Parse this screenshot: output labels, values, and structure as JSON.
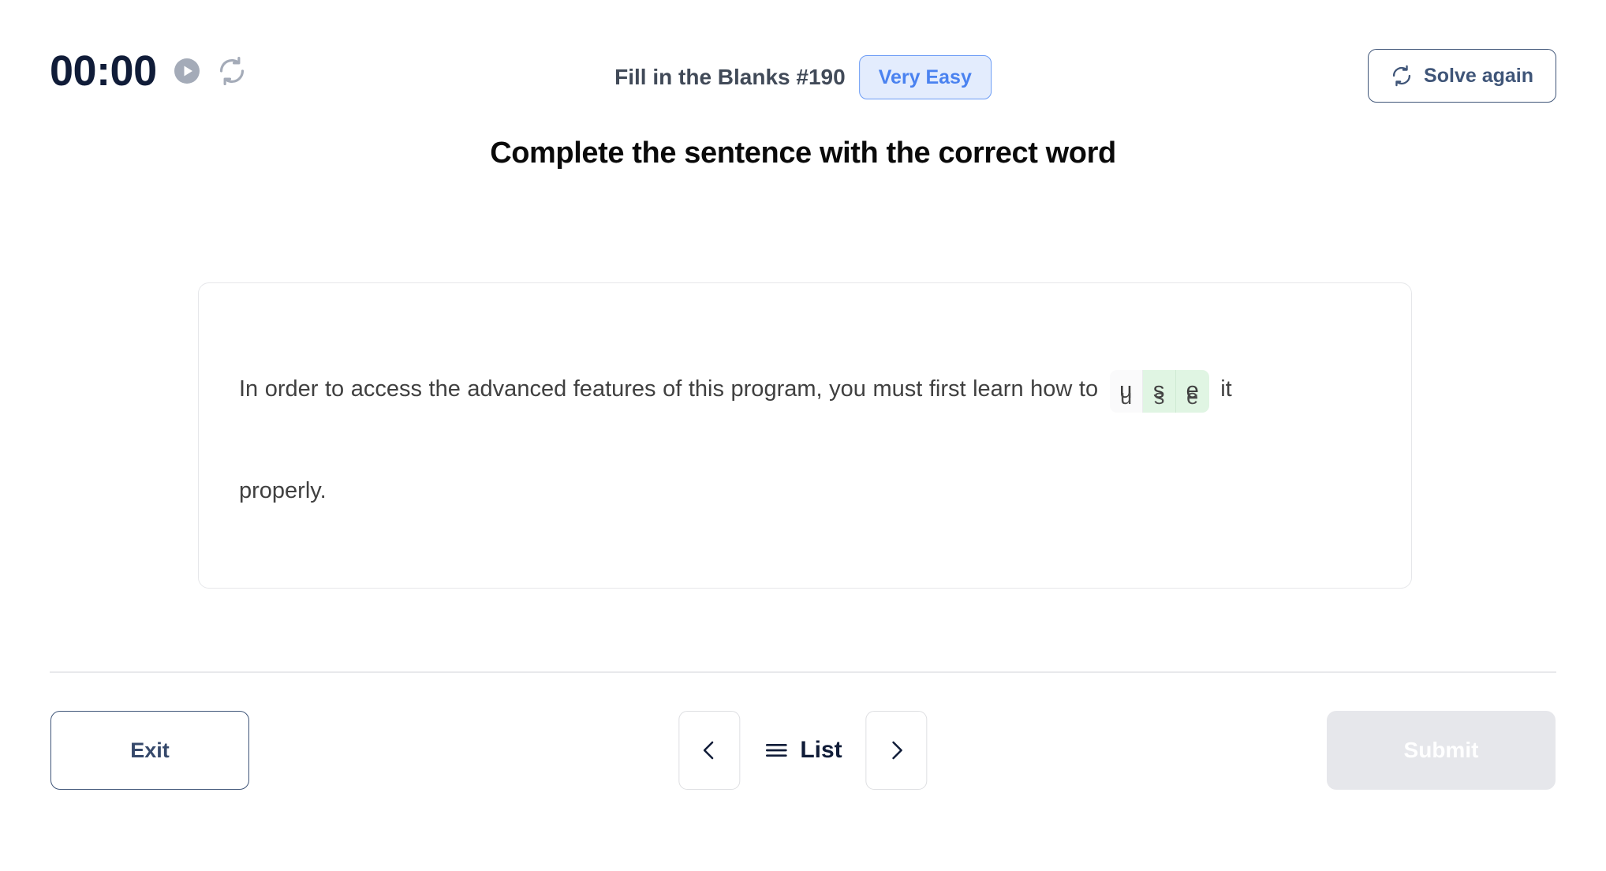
{
  "header": {
    "timer": "00:00",
    "play_icon": "play-circle-icon",
    "reset_icon": "reset-cycle-icon",
    "puzzle_title": "Fill in the Blanks #190",
    "difficulty": "Very Easy",
    "difficulty_color": "#4a82f0",
    "difficulty_bg": "#e3ecfd",
    "solve_again_label": "Solve again",
    "solve_again_icon": "refresh-cycle-icon"
  },
  "instruction": "Complete the sentence with the correct word",
  "question": {
    "text_before": "In order to access the advanced features of this program, you must first learn how to ",
    "text_after": " it",
    "text_second_line": "properly.",
    "blank": {
      "cells": [
        {
          "letter": "u",
          "filled": false
        },
        {
          "letter": "s",
          "filled": true
        },
        {
          "letter": "e",
          "filled": true
        }
      ],
      "hint_letters": [
        "u",
        "s",
        "e"
      ],
      "filled_bg": "#e0f5e3",
      "empty_bg": "#fafafb"
    }
  },
  "footer": {
    "exit_label": "Exit",
    "prev_icon": "chevron-left-icon",
    "next_icon": "chevron-right-icon",
    "list_label": "List",
    "list_icon": "hamburger-menu-icon",
    "submit_label": "Submit",
    "submit_disabled": true
  }
}
